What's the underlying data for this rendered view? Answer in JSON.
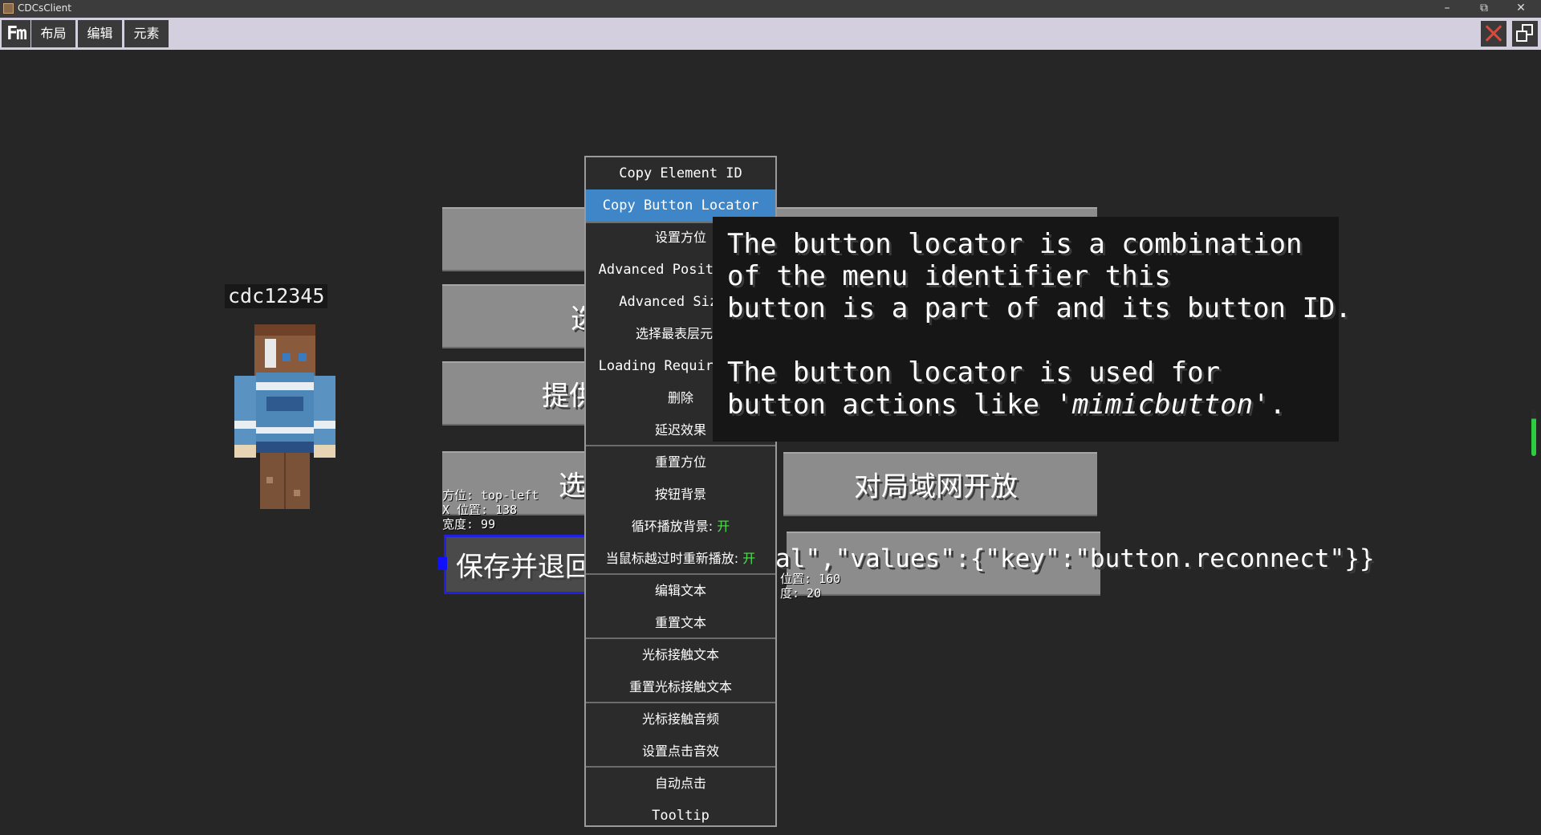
{
  "window": {
    "title": "CDCsClient",
    "minimize": "–",
    "restore": "⧉",
    "close": "✕"
  },
  "toolbar": {
    "logo": "Fm",
    "menus": [
      "布局",
      "编辑",
      "元素"
    ]
  },
  "player": {
    "name": "cdc12345"
  },
  "buttons": {
    "b2_partial": "选",
    "b3_partial": "提供",
    "b4_partial": "选",
    "lan": "对局域网开放",
    "save_partial": "保存并退回"
  },
  "element_info_left": {
    "anchor": "方位: top-left",
    "x_pos": "X 位置: 138",
    "width": "宽度: 99"
  },
  "element_info_right": {
    "y_pos": "位置: 160",
    "height": "度: 20"
  },
  "json_overlay": "al\",\"values\":{\"key\":\"button.reconnect\"}}",
  "context_menu": {
    "items": [
      {
        "label": "Copy Element ID",
        "en": true
      },
      {
        "label": "Copy Button Locator",
        "en": true,
        "active": true
      },
      {
        "label": "设置方位"
      },
      {
        "label": "Advanced Positioning",
        "en": true
      },
      {
        "label": "Advanced Sizing",
        "en": true
      },
      {
        "label": "选择最表层元素"
      },
      {
        "label": "Loading Requirements",
        "en": true
      },
      {
        "label": "删除"
      },
      {
        "label": "延迟效果"
      },
      {
        "label": "重置方位"
      },
      {
        "label": "按钮背景"
      },
      {
        "label": "循环播放背景: ",
        "state": "开"
      },
      {
        "label": "当鼠标越过时重新播放: ",
        "state": "开"
      },
      {
        "label": "编辑文本"
      },
      {
        "label": "重置文本"
      },
      {
        "label": "光标接触文本"
      },
      {
        "label": "重置光标接触文本"
      },
      {
        "label": "光标接触音频"
      },
      {
        "label": "设置点击音效"
      },
      {
        "label": "自动点击"
      },
      {
        "label": "Tooltip",
        "en": true
      }
    ]
  },
  "tooltip": {
    "line1": "The button locator is a combination",
    "line2": "of the menu identifier this",
    "line3": "button is a part of and its button ID.",
    "line4": "The button locator is used for",
    "line5_prefix": "button actions like ",
    "line5_em": "'mimicbutton'",
    "line5_suffix": "."
  },
  "colors": {
    "background": "#262626",
    "toolbar": "#d4cfde",
    "menu_highlight": "#3f86c9",
    "selection": "#2020e0",
    "toggle_on": "#4be04b",
    "close_icon": "#d84a3c"
  }
}
